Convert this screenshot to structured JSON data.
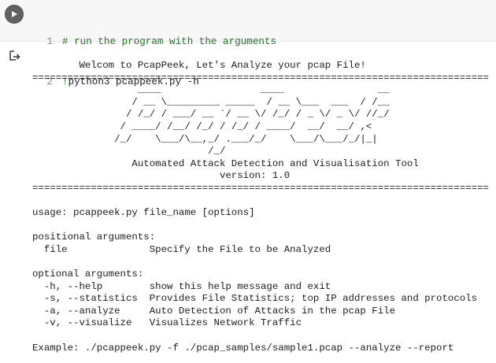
{
  "cell": {
    "code_lines": [
      {
        "number": "1",
        "text": "# run the program with the arguments",
        "kind": "comment"
      },
      {
        "number": "2",
        "text": "!python3 pcappeek.py -h",
        "kind": "shell"
      }
    ],
    "run_button_icon": "play-icon"
  },
  "output": {
    "icon": "output-redirect-icon",
    "lines": [
      "        Welcom to PcapPeek, Let's Analyze your pcap File!",
      "==============================================================================",
      "                  ____                 ____                __",
      "                 / __ \\_________ _____  / __ \\___  ___  / /__",
      "                / /_/ / ___/ __ `/ __ \\/ /_/ / _ \\/ _ \\/ //_/",
      "               / ____/ /__/ /_/ / /_/ / ____/  __/  __/ ,<",
      "              /_/    \\___/\\__,_/ .___/_/    \\___/\\___/_/|_|",
      "                              /_/",
      "                 Automated Attack Detection and Visualisation Tool",
      "                                version: 1.0",
      "==============================================================================",
      "",
      "usage: pcappeek.py file_name [options]",
      "",
      "positional arguments:",
      "  file              Specify the File to be Analyzed",
      "",
      "optional arguments:",
      "  -h, --help        show this help message and exit",
      "  -s, --statistics  Provides File Statistics; top IP addresses and protocols",
      "  -a, --analyze     Auto Detection of Attacks in the pcap File",
      "  -v, --visualize   Visualizes Network Traffic",
      "",
      "Example: ./pcappeek.py -f ./pcap_samples/sample1.pcap --analyze --report"
    ]
  }
}
